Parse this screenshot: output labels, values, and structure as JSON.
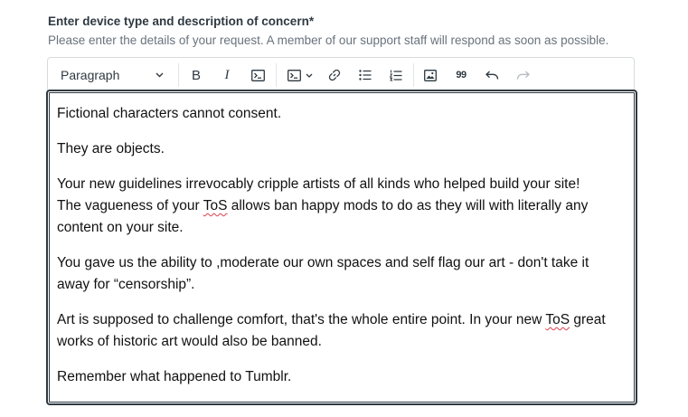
{
  "field": {
    "label": "Enter device type and description of concern*",
    "hint": "Please enter the details of your request. A member of our support staff will respond as soon as possible."
  },
  "toolbar": {
    "paragraph_select": "Paragraph",
    "bold": "B",
    "italic": "I",
    "quote_glyph": "99"
  },
  "editor": {
    "p1": "Fictional characters cannot consent.",
    "p2": "They are objects.",
    "p3_line1": "Your new guidelines irrevocably cripple artists of all kinds who helped build your site!",
    "p3_line2_a": "The vagueness of your ",
    "p3_tos1": "ToS",
    "p3_line2_b": " allows ban happy mods to do as they will with literally any content on your site.",
    "p4": "You gave us the ability to ,moderate our own spaces and self flag our art - don't take it away for “censorship”.",
    "p5_a": "Art is supposed to challenge comfort, that's the whole entire point. In your new ",
    "p5_tos": "ToS",
    "p5_b": " great works of historic art would also be banned.",
    "p6": "Remember what happened to Tumblr."
  },
  "colors": {
    "text": "#2f3941",
    "hint": "#68737d",
    "spellcheck": "#d93f4c"
  }
}
